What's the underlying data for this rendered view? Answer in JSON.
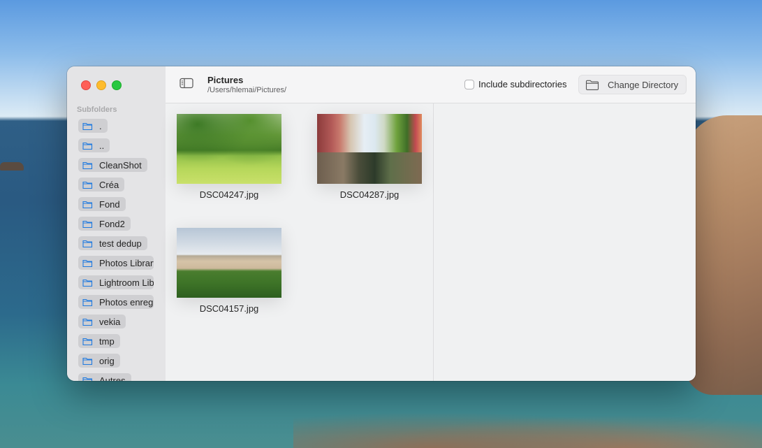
{
  "window": {
    "title": "Pictures",
    "path": "/Users/hlemai/Pictures/"
  },
  "sidebar": {
    "heading": "Subfolders",
    "items": [
      {
        "label": "."
      },
      {
        "label": ".."
      },
      {
        "label": "CleanShot"
      },
      {
        "label": "Créa"
      },
      {
        "label": "Fond"
      },
      {
        "label": "Fond2"
      },
      {
        "label": "test dedup"
      },
      {
        "label": "Photos Library"
      },
      {
        "label": "Lightroom Library"
      },
      {
        "label": "Photos enregistrées"
      },
      {
        "label": "vekia"
      },
      {
        "label": "tmp"
      },
      {
        "label": "orig"
      },
      {
        "label": "Autres"
      }
    ]
  },
  "toolbar": {
    "include_subdirectories_label": "Include subdirectories",
    "include_subdirectories_checked": false,
    "change_directory_label": "Change Directory"
  },
  "photos": [
    {
      "filename": "DSC04247.jpg"
    },
    {
      "filename": "DSC04287.jpg"
    },
    {
      "filename": "DSC04157.jpg"
    }
  ],
  "colors": {
    "close": "#fe5f57",
    "minimize": "#febc2e",
    "maximize": "#28c840",
    "folder_accent": "#1f7ae0"
  },
  "icons": {
    "sidebar_toggle": "sidebar-toggle-icon",
    "folder": "folder-icon",
    "folder_outline": "folder-outline-icon"
  }
}
